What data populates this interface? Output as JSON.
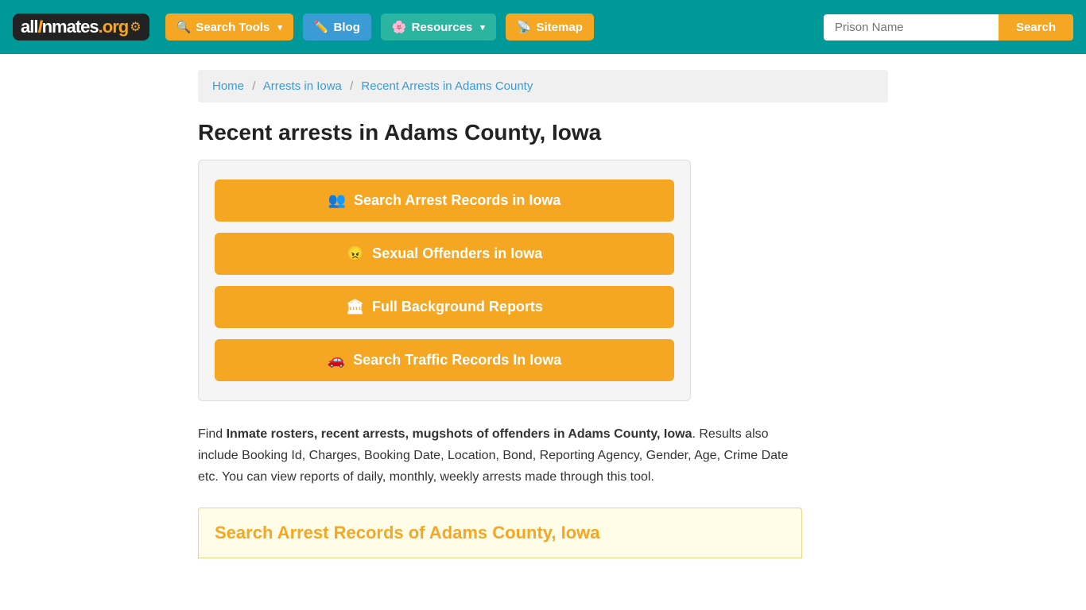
{
  "header": {
    "logo": {
      "part1": "all",
      "part2": "I",
      "part3": "nmates",
      "part4": ".org"
    },
    "nav": {
      "search_tools": "Search Tools",
      "blog": "Blog",
      "resources": "Resources",
      "sitemap": "Sitemap"
    },
    "search": {
      "placeholder": "Prison Name",
      "button_label": "Search"
    }
  },
  "breadcrumb": {
    "home": "Home",
    "arrests_in_iowa": "Arrests in Iowa",
    "current": "Recent Arrests in Adams County"
  },
  "page": {
    "title": "Recent arrests in Adams County, Iowa",
    "buttons": [
      {
        "id": "search-arrest-records",
        "label": "Search Arrest Records in Iowa",
        "icon": "people"
      },
      {
        "id": "sexual-offenders",
        "label": "Sexual Offenders in Iowa",
        "icon": "offender"
      },
      {
        "id": "full-background-reports",
        "label": "Full Background Reports",
        "icon": "building"
      },
      {
        "id": "search-traffic-records",
        "label": "Search Traffic Records In Iowa",
        "icon": "car"
      }
    ],
    "description": {
      "prefix": "Find ",
      "bold_text": "Inmate rosters, recent arrests, mugshots of offenders in Adams County, Iowa",
      "suffix": ". Results also include Booking Id, Charges, Booking Date, Location, Bond, Reporting Agency, Gender, Age, Crime Date etc. You can view reports of daily, monthly, weekly arrests made through this tool."
    },
    "search_section_heading": "Search Arrest Records of Adams County, Iowa"
  }
}
